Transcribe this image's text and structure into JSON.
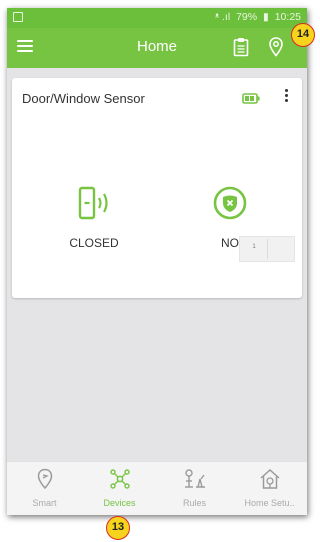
{
  "status_bar": {
    "signal_text": "ᵜ .ıl",
    "battery": "79%",
    "time": "10:25"
  },
  "app_bar": {
    "title": "Home"
  },
  "device_card": {
    "name": "Door/Window Sensor",
    "status1_label": "CLOSED",
    "status2_label": "NO",
    "mini_table_value": "1"
  },
  "bottom_nav": [
    {
      "label": "Smart",
      "icon": "location-pin-icon",
      "active": false
    },
    {
      "label": "Devices",
      "icon": "network-nodes-icon",
      "active": true
    },
    {
      "label": "Rules",
      "icon": "rules-icon",
      "active": false
    },
    {
      "label": "Home Setu..",
      "icon": "home-setup-icon",
      "active": false
    }
  ],
  "callouts": {
    "top": "14",
    "bottom": "13"
  },
  "colors": {
    "accent": "#76c442",
    "statusbar": "#6cbf3a",
    "badge_fill": "#f6d31c",
    "badge_border": "#d92a24"
  }
}
